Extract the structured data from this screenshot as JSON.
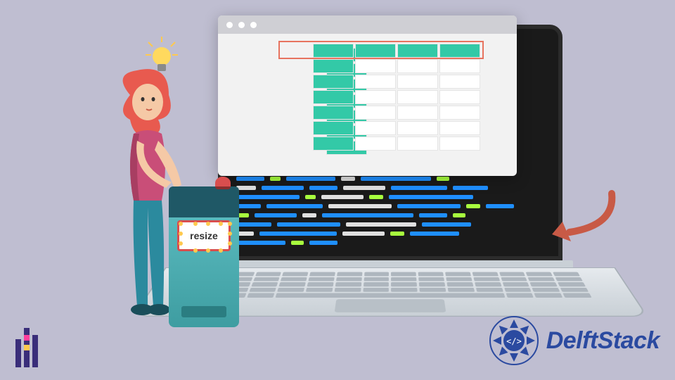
{
  "podium": {
    "sign_label": "resize"
  },
  "brand": {
    "name": "DelftStack"
  },
  "icons": {
    "lightbulb": "lightbulb-icon",
    "arrow": "curved-arrow-icon",
    "mandala": "mandala-logo-icon"
  },
  "colors": {
    "bg": "#bfbed1",
    "teal": "#33c9a7",
    "brand_blue": "#2b4aa0",
    "code_blue": "#1f8fff",
    "code_lime": "#a8ff3e"
  }
}
